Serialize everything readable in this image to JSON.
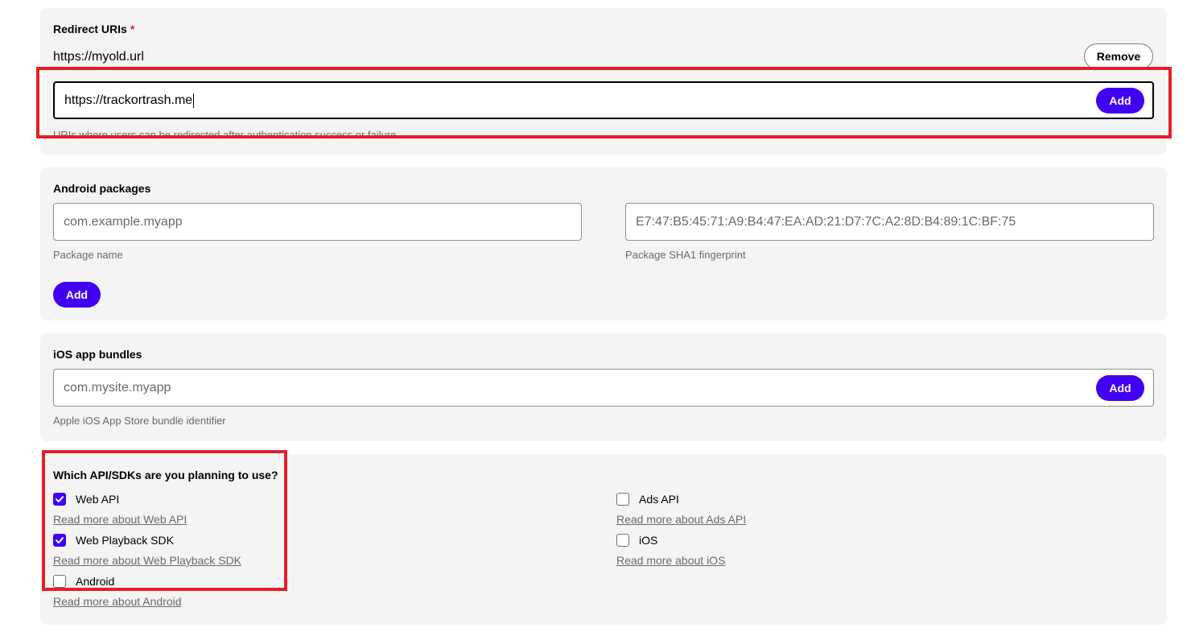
{
  "redirect": {
    "label": "Redirect URIs",
    "required_mark": "*",
    "existing_uri": "https://myold.url",
    "remove_label": "Remove",
    "input_value": "https://trackortrash.me",
    "add_label": "Add",
    "helper": "URIs where users can be redirected after authentication success or failure"
  },
  "android": {
    "label": "Android packages",
    "package_placeholder": "com.example.myapp",
    "fingerprint_placeholder": "E7:47:B5:45:71:A9:B4:47:EA:AD:21:D7:7C:A2:8D:B4:89:1C:BF:75",
    "package_helper": "Package name",
    "fingerprint_helper": "Package SHA1 fingerprint",
    "add_label": "Add"
  },
  "ios": {
    "label": "iOS app bundles",
    "placeholder": "com.mysite.myapp",
    "add_label": "Add",
    "helper": "Apple iOS App Store bundle identifier"
  },
  "apis": {
    "label": "Which API/SDKs are you planning to use?",
    "options": [
      {
        "name": "Web API",
        "checked": true,
        "link": "Read more about Web API"
      },
      {
        "name": "Web Playback SDK",
        "checked": true,
        "link": "Read more about Web Playback SDK"
      },
      {
        "name": "Android",
        "checked": false,
        "link": "Read more about Android"
      },
      {
        "name": "Ads API",
        "checked": false,
        "link": "Read more about Ads API"
      },
      {
        "name": "iOS",
        "checked": false,
        "link": "Read more about iOS"
      }
    ]
  },
  "colors": {
    "accent": "#4100f4",
    "highlight": "#e3202a",
    "card_bg": "#f4f4f4"
  }
}
